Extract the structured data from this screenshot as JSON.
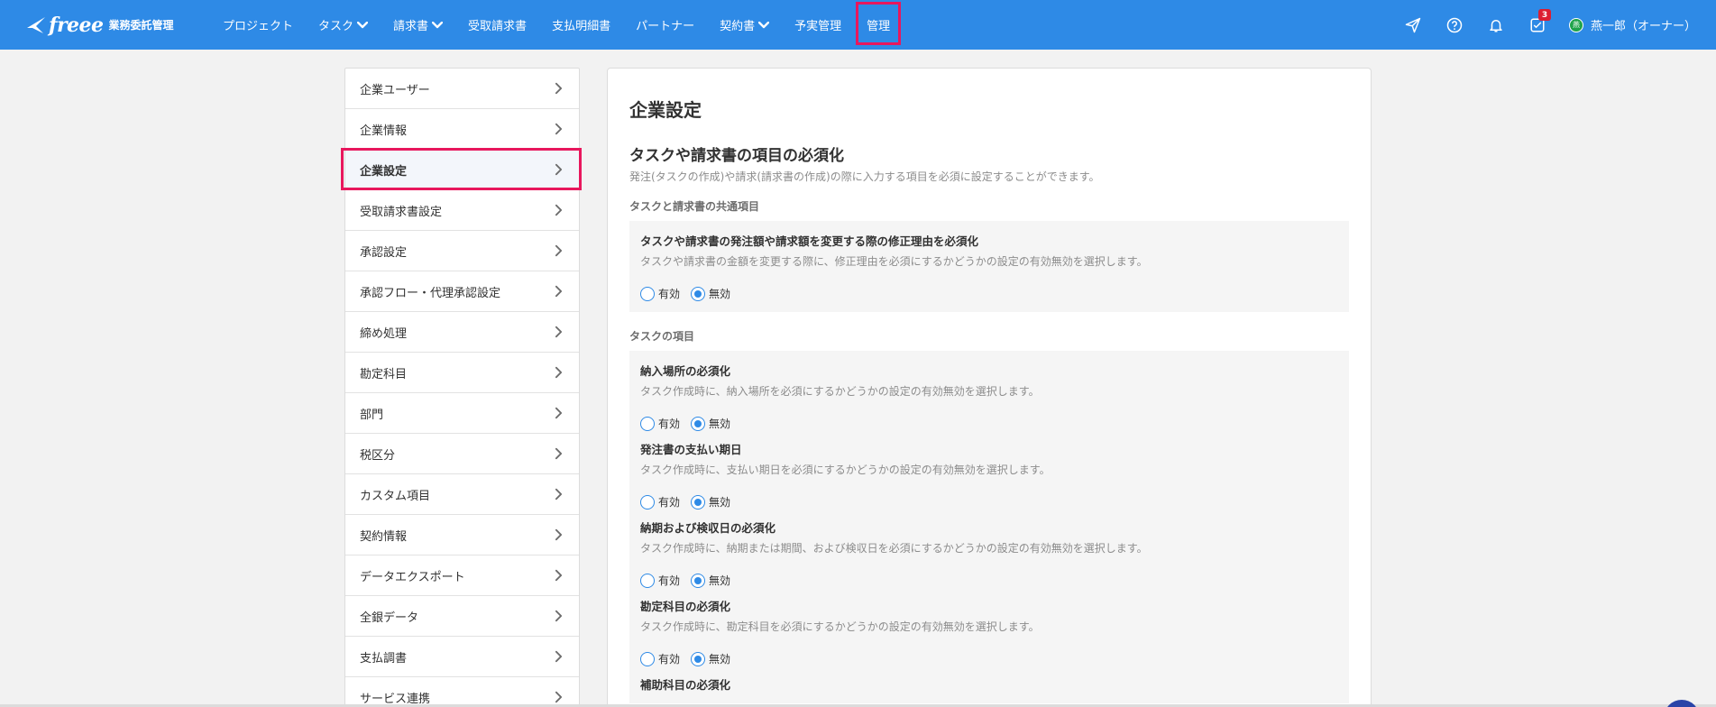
{
  "app": {
    "logo_text": "freee",
    "logo_subtitle": "業務委託管理"
  },
  "nav": {
    "items": [
      {
        "label": "プロジェクト",
        "dropdown": false
      },
      {
        "label": "タスク",
        "dropdown": true
      },
      {
        "label": "請求書",
        "dropdown": true
      },
      {
        "label": "受取請求書",
        "dropdown": false
      },
      {
        "label": "支払明細書",
        "dropdown": false
      },
      {
        "label": "パートナー",
        "dropdown": false
      },
      {
        "label": "契約書",
        "dropdown": true
      },
      {
        "label": "予実管理",
        "dropdown": false
      },
      {
        "label": "管理",
        "dropdown": false
      }
    ],
    "notifications_badge": "3",
    "user_initial": "燕",
    "user_label": "燕一郎（オーナー）",
    "icons": [
      "send-icon",
      "help-icon",
      "bell-icon",
      "task-check-icon"
    ]
  },
  "sidebar": {
    "items": [
      {
        "label": "企業ユーザー"
      },
      {
        "label": "企業情報"
      },
      {
        "label": "企業設定"
      },
      {
        "label": "受取請求書設定"
      },
      {
        "label": "承認設定"
      },
      {
        "label": "承認フロー・代理承認設定"
      },
      {
        "label": "締め処理"
      },
      {
        "label": "勘定科目"
      },
      {
        "label": "部門"
      },
      {
        "label": "税区分"
      },
      {
        "label": "カスタム項目"
      },
      {
        "label": "契約情報"
      },
      {
        "label": "データエクスポート"
      },
      {
        "label": "全銀データ"
      },
      {
        "label": "支払調書"
      },
      {
        "label": "サービス連携"
      }
    ],
    "active_index": 2
  },
  "main": {
    "title": "企業設定",
    "section_title": "タスクや請求書の項目の必須化",
    "section_desc": "発注(タスクの作成)や請求(請求書の作成)の際に入力する項目を必須に設定することができます。",
    "group1_label": "タスクと請求書の共通項目",
    "group2_label": "タスクの項目",
    "radio_enabled": "有効",
    "radio_disabled": "無効",
    "common_settings": [
      {
        "title": "タスクや請求書の発注額や請求額を変更する際の修正理由を必須化",
        "desc": "タスクや請求書の金額を変更する際に、修正理由を必須にするかどうかの設定の有効無効を選択します。",
        "value": "無効"
      }
    ],
    "task_settings": [
      {
        "title": "納入場所の必須化",
        "desc": "タスク作成時に、納入場所を必須にするかどうかの設定の有効無効を選択します。",
        "value": "無効"
      },
      {
        "title": "発注書の支払い期日",
        "desc": "タスク作成時に、支払い期日を必須にするかどうかの設定の有効無効を選択します。",
        "value": "無効"
      },
      {
        "title": "納期および検収日の必須化",
        "desc": "タスク作成時に、納期または期間、および検収日を必須にするかどうかの設定の有効無効を選択します。",
        "value": "無効"
      },
      {
        "title": "勘定科目の必須化",
        "desc": "タスク作成時に、勘定科目を必須にするかどうかの設定の有効無効を選択します。",
        "value": "無効"
      },
      {
        "title": "補助科目の必須化",
        "desc": "",
        "value": ""
      }
    ]
  },
  "colors": {
    "navbar": "#2e8ae6",
    "highlight": "#e8175d",
    "radio": "#2e8ae6",
    "badge": "#dc1e32"
  }
}
